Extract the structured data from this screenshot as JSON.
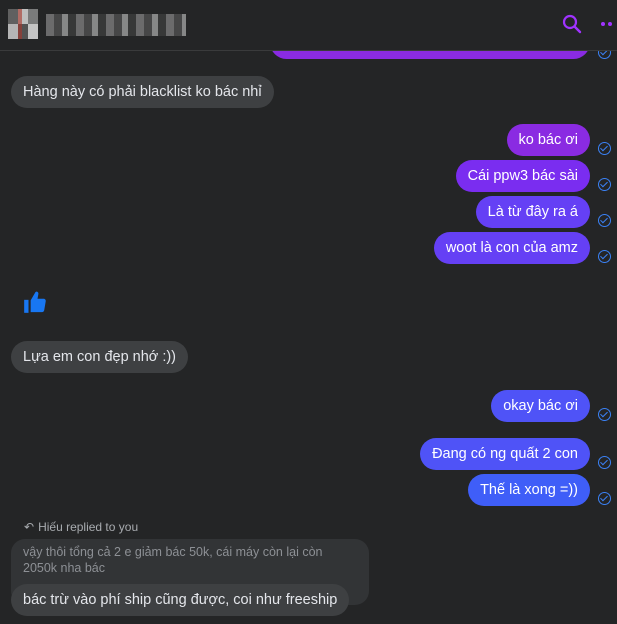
{
  "colors": {
    "background": "#242526",
    "incoming_bubble": "#3e4042",
    "accent": "#a033ff",
    "read_receipt": "#3b82f6"
  },
  "header": {
    "search_icon": "search-icon",
    "more_icon": "more-icon"
  },
  "messages": [
    {
      "side": "in",
      "text": "Hàng này có phải blacklist ko bác nhỉ"
    },
    {
      "side": "out",
      "text": "ko bác ơi"
    },
    {
      "side": "out",
      "text": "Cái ppw3 bác sài"
    },
    {
      "side": "out",
      "text": "Là từ đây ra á"
    },
    {
      "side": "out",
      "text": "woot là con của amz"
    },
    {
      "side": "in",
      "icon": "thumbs-up-icon"
    },
    {
      "side": "in",
      "text": "Lựa em con đẹp nhớ :))"
    },
    {
      "side": "out",
      "text": "okay bác ơi"
    },
    {
      "side": "out",
      "text": "Đang có ng quất 2 con"
    },
    {
      "side": "out",
      "text": "Thế là xong =))"
    }
  ],
  "reply": {
    "label": "Hiếu replied to you",
    "quoted": "vậy thôi tổng cả 2 e giảm bác 50k, cái máy còn lại còn\n2050k nha bác",
    "text": "bác trừ vào phí ship cũng được, coi như freeship"
  }
}
